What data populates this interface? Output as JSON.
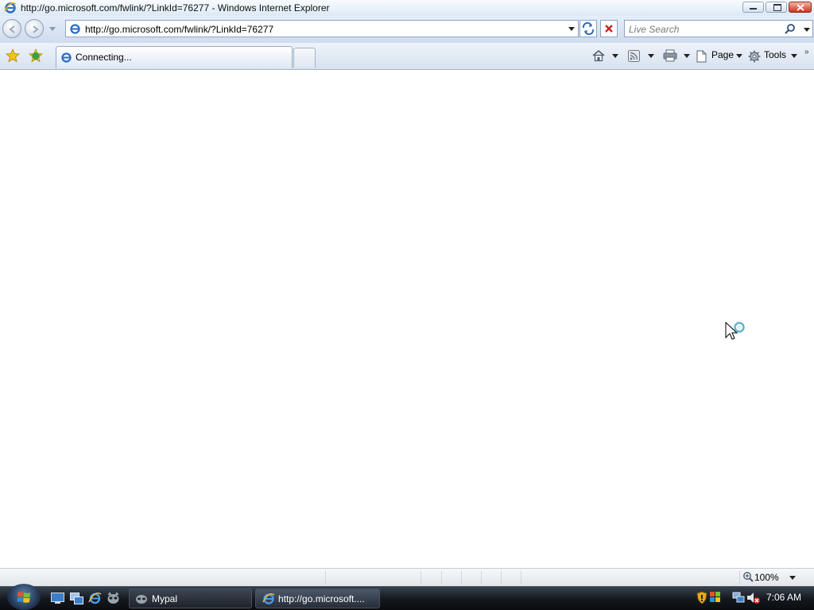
{
  "window": {
    "title": "http://go.microsoft.com/fwlink/?LinkId=76277 - Windows Internet Explorer"
  },
  "navigation": {
    "address": "http://go.microsoft.com/fwlink/?LinkId=76277",
    "search_placeholder": "Live Search"
  },
  "tabs": [
    {
      "label": "Connecting..."
    }
  ],
  "commands": {
    "page_label": "Page",
    "tools_label": "Tools"
  },
  "statusbar": {
    "zoom": "100%"
  },
  "taskbar": {
    "buttons": [
      {
        "label": "Mypal"
      },
      {
        "label": "http://go.microsoft...."
      }
    ],
    "clock": "7:06 AM"
  },
  "colors": {
    "accent": "#2a6fc2",
    "stop": "#cc2222"
  }
}
